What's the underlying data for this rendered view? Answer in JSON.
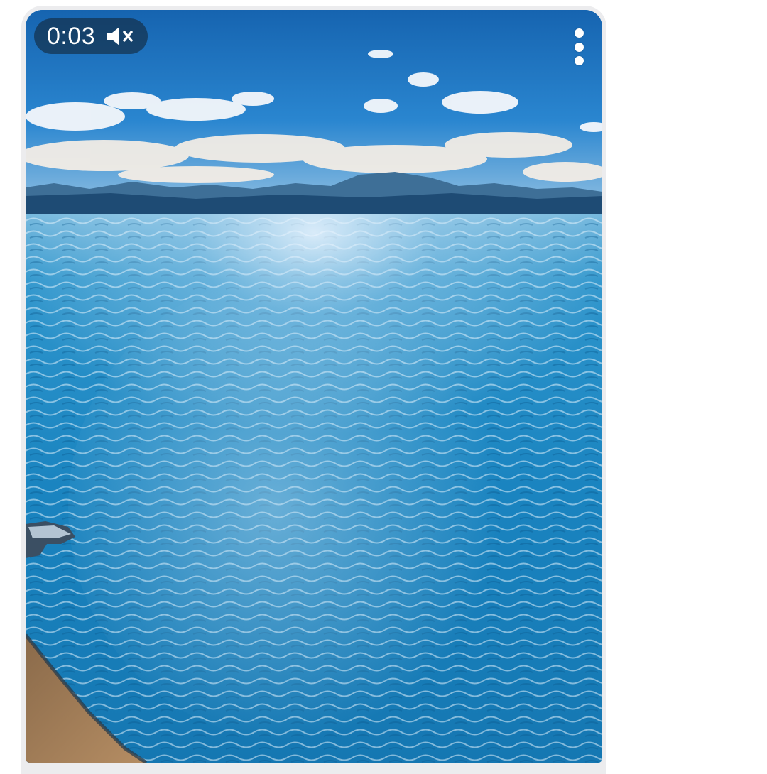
{
  "video": {
    "elapsed_time": "0:03",
    "muted": true,
    "controls": {
      "mute_icon": "speaker-muted-icon",
      "more_icon": "vertical-ellipsis-icon"
    }
  },
  "colors": {
    "sky": "#1d76c4",
    "water": "#1b86c2",
    "overlay_pill": "#14283c",
    "card_border": "#ececee"
  }
}
